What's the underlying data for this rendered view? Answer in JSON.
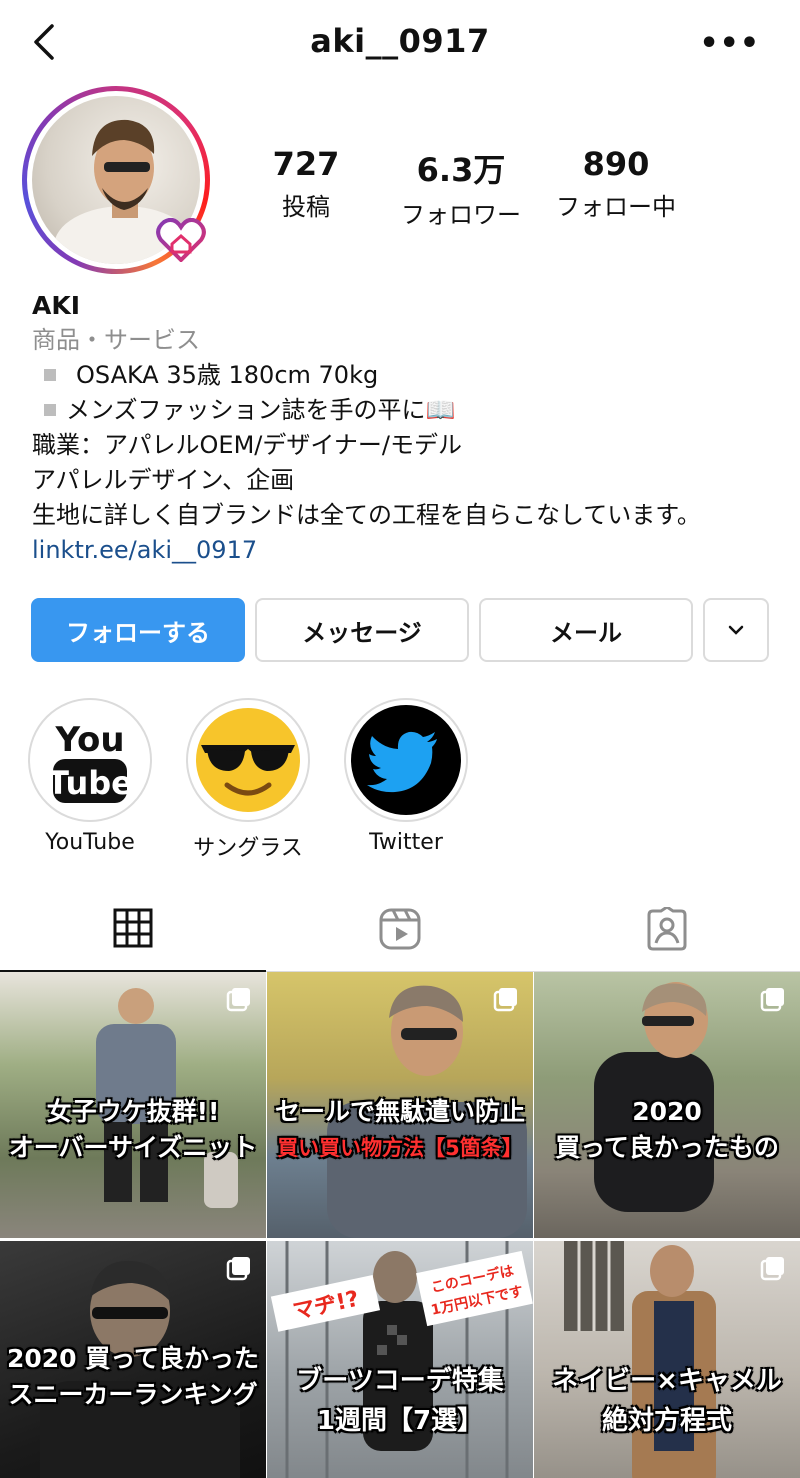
{
  "header": {
    "username": "aki__0917"
  },
  "stats": [
    {
      "value": "727",
      "label": "投稿"
    },
    {
      "value": "6.3万",
      "label": "フォロワー"
    },
    {
      "value": "890",
      "label": "フォロー中"
    }
  ],
  "bio": {
    "name": "AKI",
    "category": "商品・サービス",
    "line1": "OSAKA 35歳 180cm 70kg",
    "line2": "メンズファッション誌を手の平に📖",
    "line3": "職業：アパレルOEM/デザイナー/モデル",
    "line4": "アパレルデザイン、企画",
    "line5": "生地に詳しく自ブランドは全ての工程を自らこなしています。",
    "link": "linktr.ee/aki__0917"
  },
  "buttons": {
    "follow": "フォローする",
    "message": "メッセージ",
    "mail": "メール"
  },
  "highlights": [
    {
      "label": "YouTube"
    },
    {
      "label": "サングラス"
    },
    {
      "label": "Twitter"
    }
  ],
  "posts": [
    {
      "line1": "女子ウケ抜群!!",
      "line2": "オーバーサイズニット"
    },
    {
      "line1": "セールで無駄遣い防止",
      "line2": "買い買い物方法【5箇条】"
    },
    {
      "line1": "2020",
      "line2": "買って良かったもの"
    },
    {
      "line1": "2020 買って良かった",
      "line2": "スニーカーランキング"
    },
    {
      "tag1": "マヂ!?",
      "tag2": "このコーデは",
      "tag3": "1万円以下です",
      "line1": "ブーツコーデ特集",
      "line2": "1週間【7選】"
    },
    {
      "line1": "ネイビー×キャメル",
      "line2": "絶対方程式"
    }
  ],
  "colors": {
    "follow_button": "#3897f0",
    "link": "#1b4f8c",
    "muted": "#8e8e8e",
    "red_caption": "#ff3030"
  }
}
